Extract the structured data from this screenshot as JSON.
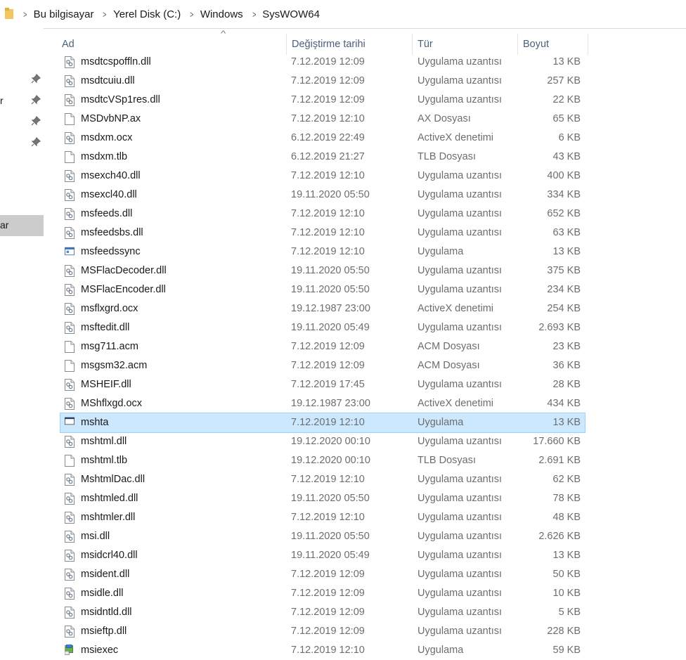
{
  "breadcrumb": [
    "Bu bilgisayar",
    "Yerel Disk (C:)",
    "Windows",
    "SysWOW64"
  ],
  "left_pane": {
    "labels": [
      "r",
      "ar"
    ]
  },
  "columns": {
    "name": "Ad",
    "date": "Değiştirme tarihi",
    "type": "Tür",
    "size": "Boyut"
  },
  "files": [
    {
      "name": "msdtcspoffln.dll",
      "date": "7.12.2019 12:09",
      "type": "Uygulama uzantısı",
      "size": "13 KB",
      "icon": "dll"
    },
    {
      "name": "msdtcuiu.dll",
      "date": "7.12.2019 12:09",
      "type": "Uygulama uzantısı",
      "size": "257 KB",
      "icon": "dll"
    },
    {
      "name": "msdtcVSp1res.dll",
      "date": "7.12.2019 12:09",
      "type": "Uygulama uzantısı",
      "size": "22 KB",
      "icon": "dll"
    },
    {
      "name": "MSDvbNP.ax",
      "date": "7.12.2019 12:10",
      "type": "AX Dosyası",
      "size": "65 KB",
      "icon": "file"
    },
    {
      "name": "msdxm.ocx",
      "date": "6.12.2019 22:49",
      "type": "ActiveX denetimi",
      "size": "6 KB",
      "icon": "dll"
    },
    {
      "name": "msdxm.tlb",
      "date": "6.12.2019 21:27",
      "type": "TLB Dosyası",
      "size": "43 KB",
      "icon": "file"
    },
    {
      "name": "msexch40.dll",
      "date": "7.12.2019 12:10",
      "type": "Uygulama uzantısı",
      "size": "400 KB",
      "icon": "dll"
    },
    {
      "name": "msexcl40.dll",
      "date": "19.11.2020 05:50",
      "type": "Uygulama uzantısı",
      "size": "334 KB",
      "icon": "dll"
    },
    {
      "name": "msfeeds.dll",
      "date": "7.12.2019 12:10",
      "type": "Uygulama uzantısı",
      "size": "652 KB",
      "icon": "dll"
    },
    {
      "name": "msfeedsbs.dll",
      "date": "7.12.2019 12:10",
      "type": "Uygulama uzantısı",
      "size": "63 KB",
      "icon": "dll"
    },
    {
      "name": "msfeedssync",
      "date": "7.12.2019 12:10",
      "type": "Uygulama",
      "size": "13 KB",
      "icon": "app"
    },
    {
      "name": "MSFlacDecoder.dll",
      "date": "19.11.2020 05:50",
      "type": "Uygulama uzantısı",
      "size": "375 KB",
      "icon": "dll"
    },
    {
      "name": "MSFlacEncoder.dll",
      "date": "19.11.2020 05:50",
      "type": "Uygulama uzantısı",
      "size": "234 KB",
      "icon": "dll"
    },
    {
      "name": "msflxgrd.ocx",
      "date": "19.12.1987 23:00",
      "type": "ActiveX denetimi",
      "size": "254 KB",
      "icon": "dll"
    },
    {
      "name": "msftedit.dll",
      "date": "19.11.2020 05:49",
      "type": "Uygulama uzantısı",
      "size": "2.693 KB",
      "icon": "dll"
    },
    {
      "name": "msg711.acm",
      "date": "7.12.2019 12:09",
      "type": "ACM Dosyası",
      "size": "23 KB",
      "icon": "file"
    },
    {
      "name": "msgsm32.acm",
      "date": "7.12.2019 12:09",
      "type": "ACM Dosyası",
      "size": "36 KB",
      "icon": "file"
    },
    {
      "name": "MSHEIF.dll",
      "date": "7.12.2019 17:45",
      "type": "Uygulama uzantısı",
      "size": "28 KB",
      "icon": "dll"
    },
    {
      "name": "MShflxgd.ocx",
      "date": "19.12.1987 23:00",
      "type": "ActiveX denetimi",
      "size": "434 KB",
      "icon": "dll"
    },
    {
      "name": "mshta",
      "date": "7.12.2019 12:10",
      "type": "Uygulama",
      "size": "13 KB",
      "icon": "window",
      "selected": true
    },
    {
      "name": "mshtml.dll",
      "date": "19.12.2020 00:10",
      "type": "Uygulama uzantısı",
      "size": "17.660 KB",
      "icon": "dll"
    },
    {
      "name": "mshtml.tlb",
      "date": "19.12.2020 00:10",
      "type": "TLB Dosyası",
      "size": "2.691 KB",
      "icon": "file"
    },
    {
      "name": "MshtmlDac.dll",
      "date": "7.12.2019 12:10",
      "type": "Uygulama uzantısı",
      "size": "62 KB",
      "icon": "dll"
    },
    {
      "name": "mshtmled.dll",
      "date": "19.11.2020 05:50",
      "type": "Uygulama uzantısı",
      "size": "78 KB",
      "icon": "dll"
    },
    {
      "name": "mshtmler.dll",
      "date": "7.12.2019 12:10",
      "type": "Uygulama uzantısı",
      "size": "48 KB",
      "icon": "dll"
    },
    {
      "name": "msi.dll",
      "date": "19.11.2020 05:50",
      "type": "Uygulama uzantısı",
      "size": "2.626 KB",
      "icon": "dll"
    },
    {
      "name": "msidcrl40.dll",
      "date": "19.11.2020 05:49",
      "type": "Uygulama uzantısı",
      "size": "13 KB",
      "icon": "dll"
    },
    {
      "name": "msident.dll",
      "date": "7.12.2019 12:09",
      "type": "Uygulama uzantısı",
      "size": "50 KB",
      "icon": "dll"
    },
    {
      "name": "msidle.dll",
      "date": "7.12.2019 12:09",
      "type": "Uygulama uzantısı",
      "size": "10 KB",
      "icon": "dll"
    },
    {
      "name": "msidntld.dll",
      "date": "7.12.2019 12:09",
      "type": "Uygulama uzantısı",
      "size": "5 KB",
      "icon": "dll"
    },
    {
      "name": "msieftp.dll",
      "date": "7.12.2019 12:09",
      "type": "Uygulama uzantısı",
      "size": "228 KB",
      "icon": "dll"
    },
    {
      "name": "msiexec",
      "date": "7.12.2019 12:10",
      "type": "Uygulama",
      "size": "59 KB",
      "icon": "installer"
    }
  ],
  "colors": {
    "selected_bg": "#cce8ff",
    "selected_border": "#99d1ff",
    "header_text": "#4c607a",
    "meta_text": "#6d6d6d"
  }
}
